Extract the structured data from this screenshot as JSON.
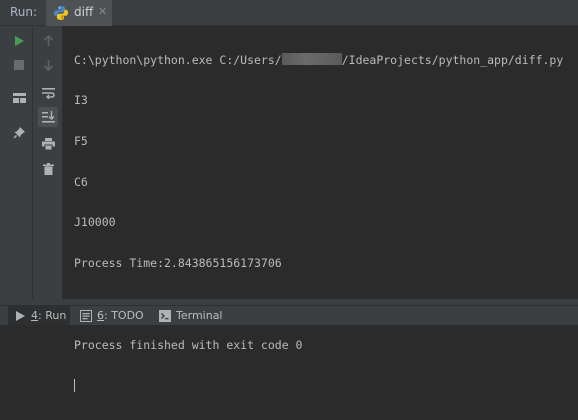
{
  "header": {
    "run_label": "Run:",
    "tab": {
      "label": "diff",
      "close": "✕"
    }
  },
  "console": {
    "command_prefix": "C:\\python\\python.exe C:/Users/",
    "command_suffix": "/IdeaProjects/python_app/diff.py",
    "output_lines": [
      "I3",
      "F5",
      "C6",
      "J10000",
      "Process Time:2.843865156173706"
    ],
    "exit_message": "Process finished with exit code 0"
  },
  "bottom_tabs": [
    {
      "mnemonic": "4",
      "label": ": Run",
      "icon": "run-icon"
    },
    {
      "mnemonic": "6",
      "label": ": TODO",
      "icon": "todo-icon"
    },
    {
      "mnemonic": "",
      "label": "Terminal",
      "icon": "terminal-icon"
    }
  ],
  "colors": {
    "run_green": "#499c54",
    "console_bg": "#2b2b2b",
    "panel_bg": "#3c3f41",
    "text": "#bbbbbb"
  }
}
